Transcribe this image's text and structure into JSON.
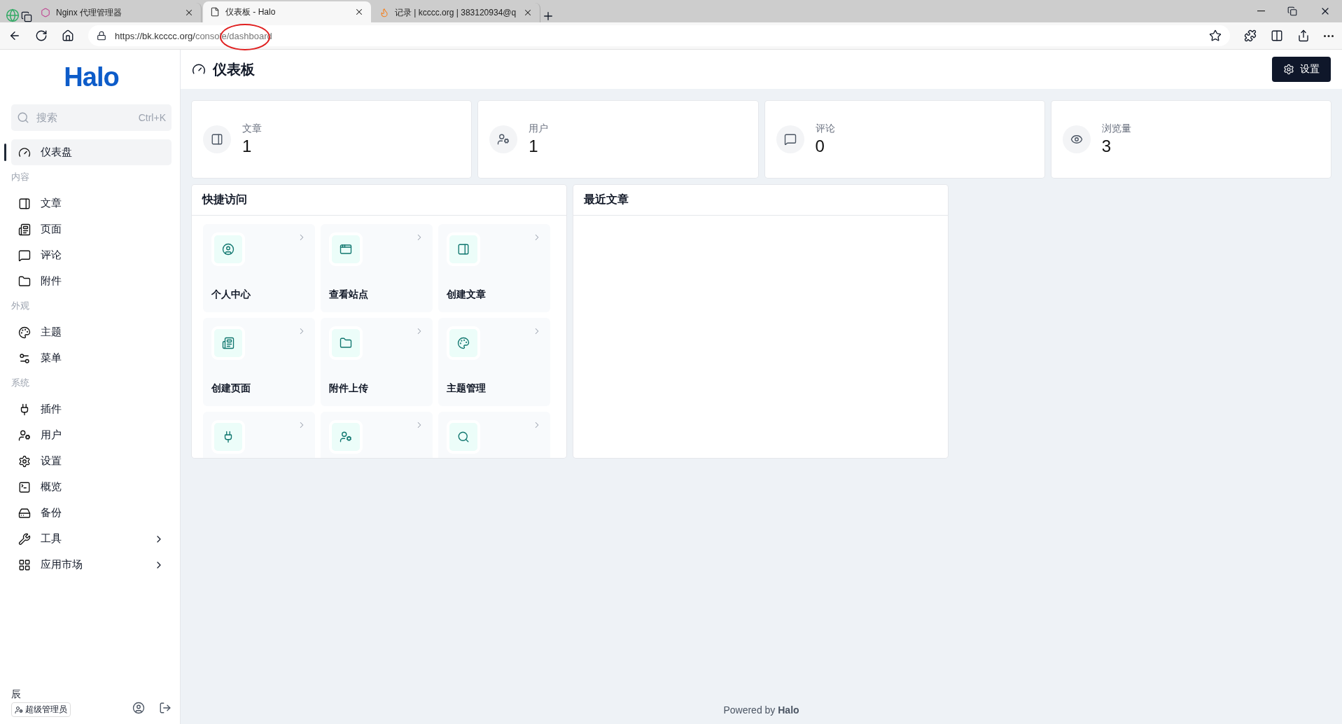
{
  "browser": {
    "tabs": [
      {
        "title": "Nginx 代理管理器",
        "selected": false
      },
      {
        "title": "仪表板 - Halo",
        "selected": true
      },
      {
        "title": "记录 | kcccc.org | 383120934@q",
        "selected": false
      }
    ],
    "url_host": "https://bk.kcccc.org/",
    "url_path": "console/dashboard"
  },
  "sidebar": {
    "logo": "Halo",
    "search": {
      "placeholder": "搜索",
      "shortcut": "Ctrl+K"
    },
    "groups": [
      {
        "items": [
          {
            "label": "仪表盘",
            "selected": true,
            "submenu": false
          }
        ]
      },
      {
        "title": "内容",
        "items": [
          {
            "label": "文章",
            "selected": false,
            "submenu": false
          },
          {
            "label": "页面",
            "selected": false,
            "submenu": false
          },
          {
            "label": "评论",
            "selected": false,
            "submenu": false
          },
          {
            "label": "附件",
            "selected": false,
            "submenu": false
          }
        ]
      },
      {
        "title": "外观",
        "items": [
          {
            "label": "主题",
            "selected": false,
            "submenu": false
          },
          {
            "label": "菜单",
            "selected": false,
            "submenu": false
          }
        ]
      },
      {
        "title": "系统",
        "items": [
          {
            "label": "插件",
            "selected": false,
            "submenu": false
          },
          {
            "label": "用户",
            "selected": false,
            "submenu": false
          },
          {
            "label": "设置",
            "selected": false,
            "submenu": false
          },
          {
            "label": "概览",
            "selected": false,
            "submenu": false
          },
          {
            "label": "备份",
            "selected": false,
            "submenu": false
          },
          {
            "label": "工具",
            "selected": false,
            "submenu": true
          },
          {
            "label": "应用市场",
            "selected": false,
            "submenu": true
          }
        ]
      }
    ],
    "user": {
      "name": "辰",
      "role": "超级管理员"
    }
  },
  "header": {
    "title": "仪表板",
    "button": "设置"
  },
  "stats": [
    {
      "label": "文章",
      "value": "1"
    },
    {
      "label": "用户",
      "value": "1"
    },
    {
      "label": "评论",
      "value": "0"
    },
    {
      "label": "浏览量",
      "value": "3"
    }
  ],
  "quick_access": {
    "title": "快捷访问",
    "items": [
      {
        "kind": "full",
        "label": "个人中心"
      },
      {
        "kind": "full",
        "label": "查看站点"
      },
      {
        "kind": "full",
        "label": "创建文章"
      },
      {
        "kind": "full",
        "label": "创建页面"
      },
      {
        "kind": "full",
        "label": "附件上传"
      },
      {
        "kind": "full",
        "label": "主题管理"
      },
      {
        "kind": "cut"
      },
      {
        "kind": "cut"
      },
      {
        "kind": "cut"
      }
    ]
  },
  "recent_posts": {
    "title": "最近文章"
  },
  "footer": "Powered by **Halo**"
}
